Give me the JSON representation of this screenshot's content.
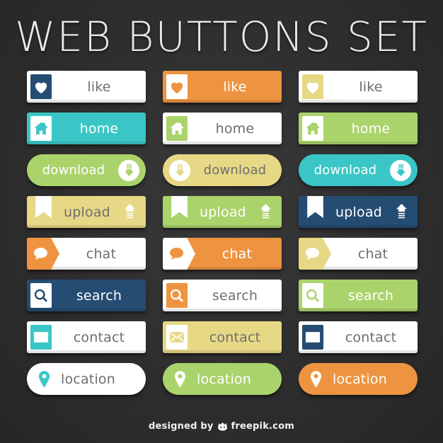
{
  "page": {
    "title": "WEB BUTTONS SET",
    "background_color": "#2f2f2f"
  },
  "palette": {
    "navy": "#254c72",
    "orange": "#ee9440",
    "yellow": "#e7d886",
    "teal": "#3ac6c6",
    "green": "#aad36b",
    "white": "#ffffff",
    "grey_text": "#6e6e6e"
  },
  "rows": [
    {
      "name": "like",
      "shape": "rect",
      "icon": "heart-icon",
      "buttons": [
        {
          "label": "like",
          "body_color": "#ffffff",
          "label_color": "#6e6e6e",
          "icon_box_color": "#254c72",
          "icon_color": "#ffffff"
        },
        {
          "label": "like",
          "body_color": "#ee9440",
          "label_color": "#ffffff",
          "icon_box_color": "#ffffff",
          "icon_color": "#ee9440"
        },
        {
          "label": "like",
          "body_color": "#ffffff",
          "label_color": "#6e6e6e",
          "icon_box_color": "#e7d886",
          "icon_color": "#ffffff"
        }
      ]
    },
    {
      "name": "home",
      "shape": "rect",
      "icon": "home-icon",
      "buttons": [
        {
          "label": "home",
          "body_color": "#3ac6c6",
          "label_color": "#ffffff",
          "icon_box_color": "#ffffff",
          "icon_color": "#3ac6c6"
        },
        {
          "label": "home",
          "body_color": "#ffffff",
          "label_color": "#6e6e6e",
          "icon_box_color": "#aad36b",
          "icon_color": "#ffffff"
        },
        {
          "label": "home",
          "body_color": "#aad36b",
          "label_color": "#ffffff",
          "icon_box_color": "#ffffff",
          "icon_color": "#aad36b"
        }
      ]
    },
    {
      "name": "download",
      "shape": "pill",
      "icon": "download-arrow-icon",
      "buttons": [
        {
          "label": "download",
          "body_color": "#aad36b",
          "label_color": "#ffffff",
          "icon_box_color": "#ffffff",
          "icon_color": "#aad36b",
          "icon_side": "right"
        },
        {
          "label": "download",
          "body_color": "#e7d886",
          "label_color": "#6e6e6e",
          "icon_box_color": "#ffffff",
          "icon_color": "#e7d886",
          "icon_side": "left"
        },
        {
          "label": "download",
          "body_color": "#3ac6c6",
          "label_color": "#ffffff",
          "icon_box_color": "#ffffff",
          "icon_color": "#3ac6c6",
          "icon_side": "right"
        }
      ]
    },
    {
      "name": "upload",
      "shape": "rect",
      "icon": "upload-arrow-icon",
      "buttons": [
        {
          "label": "upload",
          "body_color": "#e7d886",
          "label_color": "#6e6e6e",
          "icon_box_color": "#ffffff",
          "icon_color": "#ffffff"
        },
        {
          "label": "upload",
          "body_color": "#aad36b",
          "label_color": "#ffffff",
          "icon_box_color": "#ffffff",
          "icon_color": "#ffffff"
        },
        {
          "label": "upload",
          "body_color": "#254c72",
          "label_color": "#ffffff",
          "icon_box_color": "#ffffff",
          "icon_color": "#ffffff"
        }
      ]
    },
    {
      "name": "chat",
      "shape": "rect",
      "icon": "chat-bubble-icon",
      "buttons": [
        {
          "label": "chat",
          "body_color": "#ffffff",
          "label_color": "#6e6e6e",
          "icon_box_color": "#ee9440",
          "icon_color": "#ffffff"
        },
        {
          "label": "chat",
          "body_color": "#ee9440",
          "label_color": "#ffffff",
          "icon_box_color": "#ffffff",
          "icon_color": "#ee9440"
        },
        {
          "label": "chat",
          "body_color": "#ffffff",
          "label_color": "#6e6e6e",
          "icon_box_color": "#e7d886",
          "icon_color": "#ffffff"
        }
      ]
    },
    {
      "name": "search",
      "shape": "rect",
      "icon": "search-icon",
      "buttons": [
        {
          "label": "search",
          "body_color": "#254c72",
          "label_color": "#ffffff",
          "icon_box_color": "#ffffff",
          "icon_color": "#254c72"
        },
        {
          "label": "search",
          "body_color": "#ffffff",
          "label_color": "#6e6e6e",
          "icon_box_color": "#ee9440",
          "icon_color": "#ffffff"
        },
        {
          "label": "search",
          "body_color": "#aad36b",
          "label_color": "#ffffff",
          "icon_box_color": "#ffffff",
          "icon_color": "#aad36b"
        }
      ]
    },
    {
      "name": "contact",
      "shape": "rect",
      "icon": "envelope-icon",
      "buttons": [
        {
          "label": "contact",
          "body_color": "#ffffff",
          "label_color": "#6e6e6e",
          "icon_box_color": "#3ac6c6",
          "icon_color": "#ffffff"
        },
        {
          "label": "contact",
          "body_color": "#e7d886",
          "label_color": "#6e6e6e",
          "icon_box_color": "#ffffff",
          "icon_color": "#e7d886"
        },
        {
          "label": "contact",
          "body_color": "#ffffff",
          "label_color": "#6e6e6e",
          "icon_box_color": "#254c72",
          "icon_color": "#ffffff"
        }
      ]
    },
    {
      "name": "location",
      "shape": "pill",
      "icon": "map-pin-icon",
      "buttons": [
        {
          "label": "location",
          "body_color": "#ffffff",
          "label_color": "#6e6e6e",
          "icon_box_color": "#ffffff",
          "icon_color": "#3ac6c6"
        },
        {
          "label": "location",
          "body_color": "#aad36b",
          "label_color": "#ffffff",
          "icon_box_color": "#aad36b",
          "icon_color": "#ffffff"
        },
        {
          "label": "location",
          "body_color": "#ee9440",
          "label_color": "#ffffff",
          "icon_box_color": "#ee9440",
          "icon_color": "#ffffff"
        }
      ]
    }
  ],
  "footer": {
    "prefix": "designed by",
    "logo_icon": "freepik-logo-icon",
    "brand": "freepik.com"
  }
}
